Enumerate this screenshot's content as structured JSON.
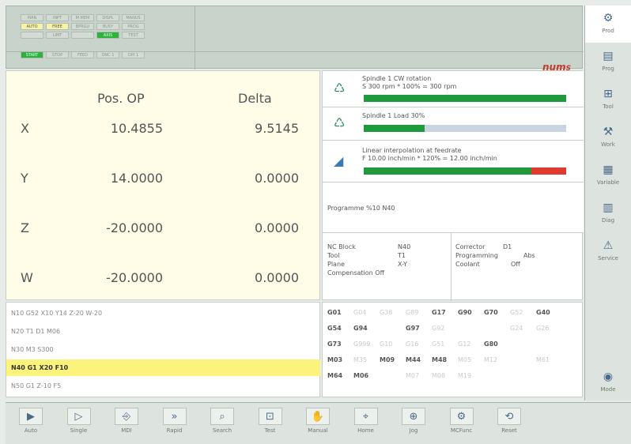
{
  "status": {
    "row1": [
      "MAN",
      "INPT",
      "M MEM",
      "DISPL",
      "MANUS"
    ],
    "row2": [
      "AUTO",
      "FREE",
      "BPRGU",
      "BUSY",
      "PROG"
    ],
    "row3": [
      "",
      "LIMT",
      "",
      "AXIS",
      "TEST"
    ],
    "row4": [
      "START",
      "STOP",
      "FEED",
      "DNC 1",
      "DPI 1"
    ],
    "logo": "num",
    "logo_mark": "S"
  },
  "sidebar": [
    {
      "label": "Prod",
      "icon": "prod-icon",
      "glyph": "⚙"
    },
    {
      "label": "Prog",
      "icon": "prog-icon",
      "glyph": "▤"
    },
    {
      "label": "Tool",
      "icon": "tool-icon",
      "glyph": "⊞"
    },
    {
      "label": "Work",
      "icon": "work-icon",
      "glyph": "⚒"
    },
    {
      "label": "Variable",
      "icon": "variable-icon",
      "glyph": "▦"
    },
    {
      "label": "Diag",
      "icon": "diag-icon",
      "glyph": "▥"
    },
    {
      "label": "Service",
      "icon": "service-icon",
      "glyph": "⚠"
    },
    {
      "label": "",
      "icon": "blank-icon",
      "glyph": ""
    },
    {
      "label": "",
      "icon": "blank-icon",
      "glyph": ""
    },
    {
      "label": "Mode",
      "icon": "mode-icon",
      "glyph": "◉"
    }
  ],
  "positions": {
    "col1": "Pos. OP",
    "col2": "Delta",
    "axes": [
      {
        "name": "X",
        "pos": "10.4855",
        "delta": "9.5145"
      },
      {
        "name": "Y",
        "pos": "14.0000",
        "delta": "0.0000"
      },
      {
        "name": "Z",
        "pos": "-20.0000",
        "delta": "0.0000"
      },
      {
        "name": "W",
        "pos": "-20.0000",
        "delta": "0.0000"
      }
    ]
  },
  "spindle": {
    "title": "Spindle 1 CW rotation",
    "detail": "S 300 rpm * 100% = 300 rpm",
    "fill_pct": 100
  },
  "load": {
    "title": "Spindle 1 Load 30%",
    "fill_pct": 30
  },
  "interp": {
    "title": "Linear interpolation at feedrate",
    "detail": "F 10.00 inch/min * 120% = 12.00 inch/min",
    "fill_pct": 83,
    "red_pct": 17
  },
  "programme": "Programme %10 N40",
  "nc": {
    "block_label": "NC Block",
    "block_value": "N40",
    "tool_label": "Tool",
    "tool_value": "T1",
    "plane_label": "Plane",
    "plane_value": "X-Y",
    "comp_label": "Compensation Off",
    "corr_label": "Corrector",
    "corr_value": "D1",
    "progm_label": "Programming",
    "progm_value": "Abs",
    "cool_label": "Coolant",
    "cool_value": "Off"
  },
  "program_lines": [
    "N10 G52 X10 Y14 Z-20 W-20",
    "N20 T1 D1 M06",
    "N30 M3 S300",
    "N40 G1 X20 F10",
    "N50 G1 Z-10 F5"
  ],
  "current_line": 3,
  "gcodes": [
    [
      [
        "G01",
        1
      ],
      [
        "G04",
        0
      ],
      [
        "G38",
        0
      ],
      [
        "G89",
        0
      ],
      [
        "G17",
        1
      ],
      [
        "G90",
        1
      ],
      [
        "G70",
        1
      ],
      [
        "G52",
        0
      ],
      [
        "G40",
        1
      ]
    ],
    [
      [
        "G54",
        1
      ],
      [
        "G94",
        1
      ],
      [
        "",
        0
      ],
      [
        "G97",
        1
      ],
      [
        "G92",
        0
      ],
      [
        "",
        0
      ],
      [
        "",
        0
      ],
      [
        "G24",
        0
      ],
      [
        "G26",
        0
      ]
    ],
    [
      [
        "G73",
        1
      ],
      [
        "G999",
        0
      ],
      [
        "G10",
        0
      ],
      [
        "G16",
        0
      ],
      [
        "G51",
        0
      ],
      [
        "G12",
        0
      ],
      [
        "G80",
        1
      ],
      [
        "",
        0
      ],
      [
        "",
        0
      ]
    ],
    [
      [
        "M03",
        1
      ],
      [
        "M35",
        0
      ],
      [
        "M09",
        1
      ],
      [
        "M44",
        1
      ],
      [
        "M48",
        1
      ],
      [
        "M05",
        0
      ],
      [
        "M12",
        0
      ],
      [
        "",
        0
      ],
      [
        "M61",
        0
      ]
    ],
    [
      [
        "M64",
        1
      ],
      [
        "M06",
        1
      ],
      [
        "",
        0
      ],
      [
        "M07",
        0
      ],
      [
        "M08",
        0
      ],
      [
        "M19",
        0
      ],
      [
        "",
        0
      ],
      [
        "",
        0
      ],
      [
        "",
        0
      ]
    ]
  ],
  "softkeys": [
    {
      "label": "Auto",
      "glyph": "▶"
    },
    {
      "label": "Single",
      "glyph": "▷"
    },
    {
      "label": "MDI",
      "glyph": "⎆"
    },
    {
      "label": "Rapid",
      "glyph": "»"
    },
    {
      "label": "Search",
      "glyph": "⌕"
    },
    {
      "label": "Test",
      "glyph": "⊡"
    },
    {
      "label": "Manual",
      "glyph": "✋"
    },
    {
      "label": "Home",
      "glyph": "⌖"
    },
    {
      "label": "Jog",
      "glyph": "⊕"
    },
    {
      "label": "MCFunc",
      "glyph": "⚙"
    },
    {
      "label": "Reset",
      "glyph": "⟲"
    }
  ]
}
